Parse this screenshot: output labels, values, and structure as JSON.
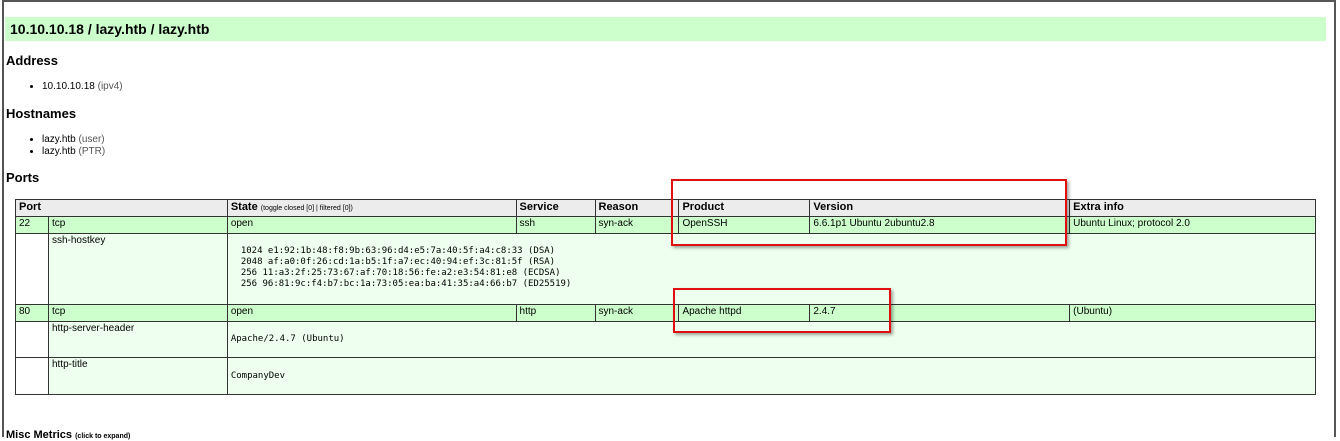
{
  "host": {
    "title": "10.10.10.18 / lazy.htb / lazy.htb"
  },
  "address": {
    "heading": "Address",
    "items": [
      {
        "value": "10.10.10.18",
        "note": "(ipv4)"
      }
    ]
  },
  "hostnames": {
    "heading": "Hostnames",
    "items": [
      {
        "value": "lazy.htb",
        "note": "(user)"
      },
      {
        "value": "lazy.htb",
        "note": "(PTR)"
      }
    ]
  },
  "ports": {
    "heading": "Ports",
    "columns": {
      "port": "Port",
      "state": "State",
      "state_toggle": "(toggle closed [0] | filtered [0])",
      "service": "Service",
      "reason": "Reason",
      "product": "Product",
      "version": "Version",
      "extra": "Extra info"
    },
    "rows": [
      {
        "port": "22",
        "proto": "tcp",
        "state": "open",
        "service": "ssh",
        "reason": "syn-ack",
        "product": "OpenSSH",
        "version": "6.6.1p1 Ubuntu 2ubuntu2.8",
        "extra": "Ubuntu Linux; protocol 2.0",
        "script": {
          "name": "ssh-hostkey",
          "output": "\n1024 e1:92:1b:48:f8:9b:63:96:d4:e5:7a:40:5f:a4:c8:33 (DSA)\n2048 af:a0:0f:26:cd:1a:b5:1f:a7:ec:40:94:ef:3c:81:5f (RSA)\n256 11:a3:2f:25:73:67:af:70:18:56:fe:a2:e3:54:81:e8 (ECDSA)\n256 96:81:9c:f4:b7:bc:1a:73:05:ea:ba:41:35:a4:66:b7 (ED25519)"
        }
      },
      {
        "port": "80",
        "proto": "tcp",
        "state": "open",
        "service": "http",
        "reason": "syn-ack",
        "product": "Apache httpd",
        "version": "2.4.7",
        "extra": "(Ubuntu)",
        "scripts": [
          {
            "name": "http-server-header",
            "output": "Apache/2.4.7 (Ubuntu)"
          },
          {
            "name": "http-title",
            "output": "CompanyDev"
          }
        ]
      }
    ]
  },
  "misc": {
    "heading": "Misc Metrics",
    "hint": "(click to expand)"
  },
  "colors": {
    "open_row": "#ccffcc",
    "script_row": "#efffef",
    "highlight": "#e01010"
  }
}
